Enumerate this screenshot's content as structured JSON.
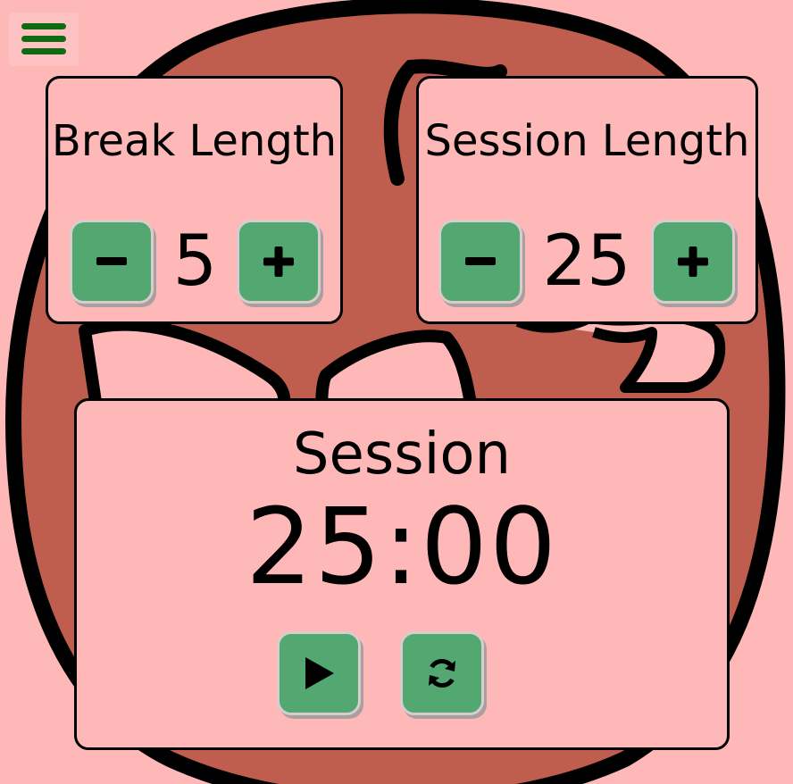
{
  "menu": {
    "icon": "hamburger-menu-icon",
    "color": "#0d6b12"
  },
  "break_card": {
    "title": "Break Length",
    "decrement_symbol": "minus-icon",
    "increment_symbol": "plus-icon",
    "value": "5"
  },
  "session_card": {
    "title": "Session Length",
    "decrement_symbol": "minus-icon",
    "increment_symbol": "plus-icon",
    "value": "25"
  },
  "timer": {
    "label": "Session",
    "display": "25:00",
    "play_icon": "play-icon",
    "reset_icon": "refresh-icon"
  },
  "colors": {
    "background": "#ffb8b8",
    "tomato": "#bf5e4e",
    "button": "#53a872",
    "text": "#000000"
  }
}
